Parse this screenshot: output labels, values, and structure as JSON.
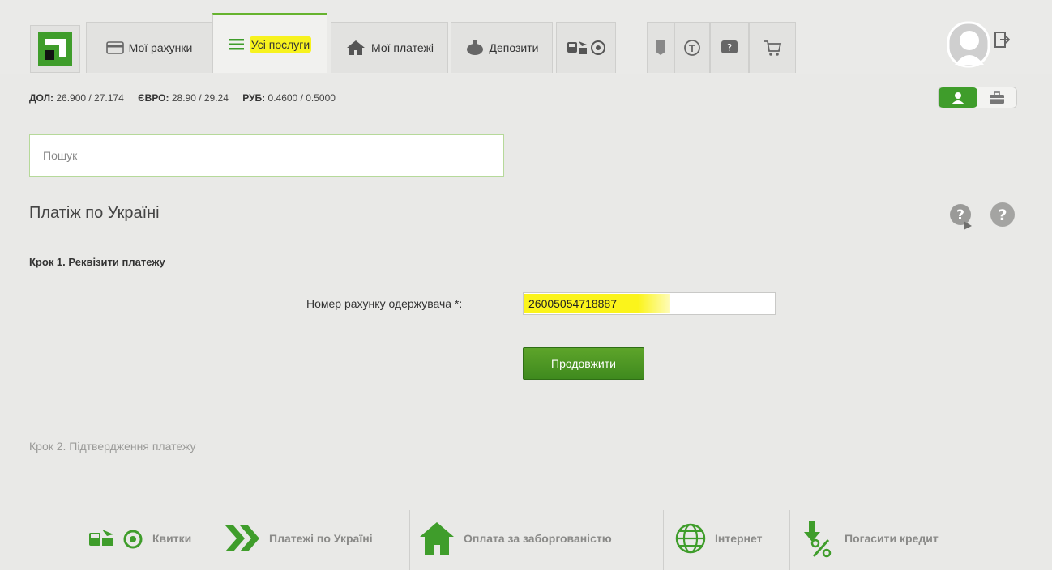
{
  "nav": {
    "tabs": [
      {
        "label": "Мої рахунки"
      },
      {
        "label": "Усі послуги"
      },
      {
        "label": "Мої платежі"
      },
      {
        "label": "Депозити"
      }
    ]
  },
  "rates": {
    "usd_label": "ДОЛ:",
    "usd_value": "26.900 / 27.174",
    "eur_label": "ЄВРО:",
    "eur_value": "28.90 / 29.24",
    "rub_label": "РУБ:",
    "rub_value": "0.4600 / 0.5000"
  },
  "search": {
    "placeholder": "Пошук"
  },
  "page": {
    "title": "Платіж по Україні"
  },
  "step1": {
    "title": "Крок 1. Реквізити платежу",
    "field_label": "Номер рахунку одержувача *:",
    "account_value": "26005054718887",
    "continue_label": "Продовжити"
  },
  "step2": {
    "title": "Крок 2. Підтвердження платежу"
  },
  "footer": {
    "items": [
      {
        "label": "Квитки"
      },
      {
        "label": "Платежі по Україні"
      },
      {
        "label": "Оплата за заборгованістю"
      },
      {
        "label": "Інтернет"
      },
      {
        "label": "Погасити кредит"
      }
    ]
  },
  "colors": {
    "accent": "#3f9d2b",
    "highlight": "#f7f21e"
  }
}
